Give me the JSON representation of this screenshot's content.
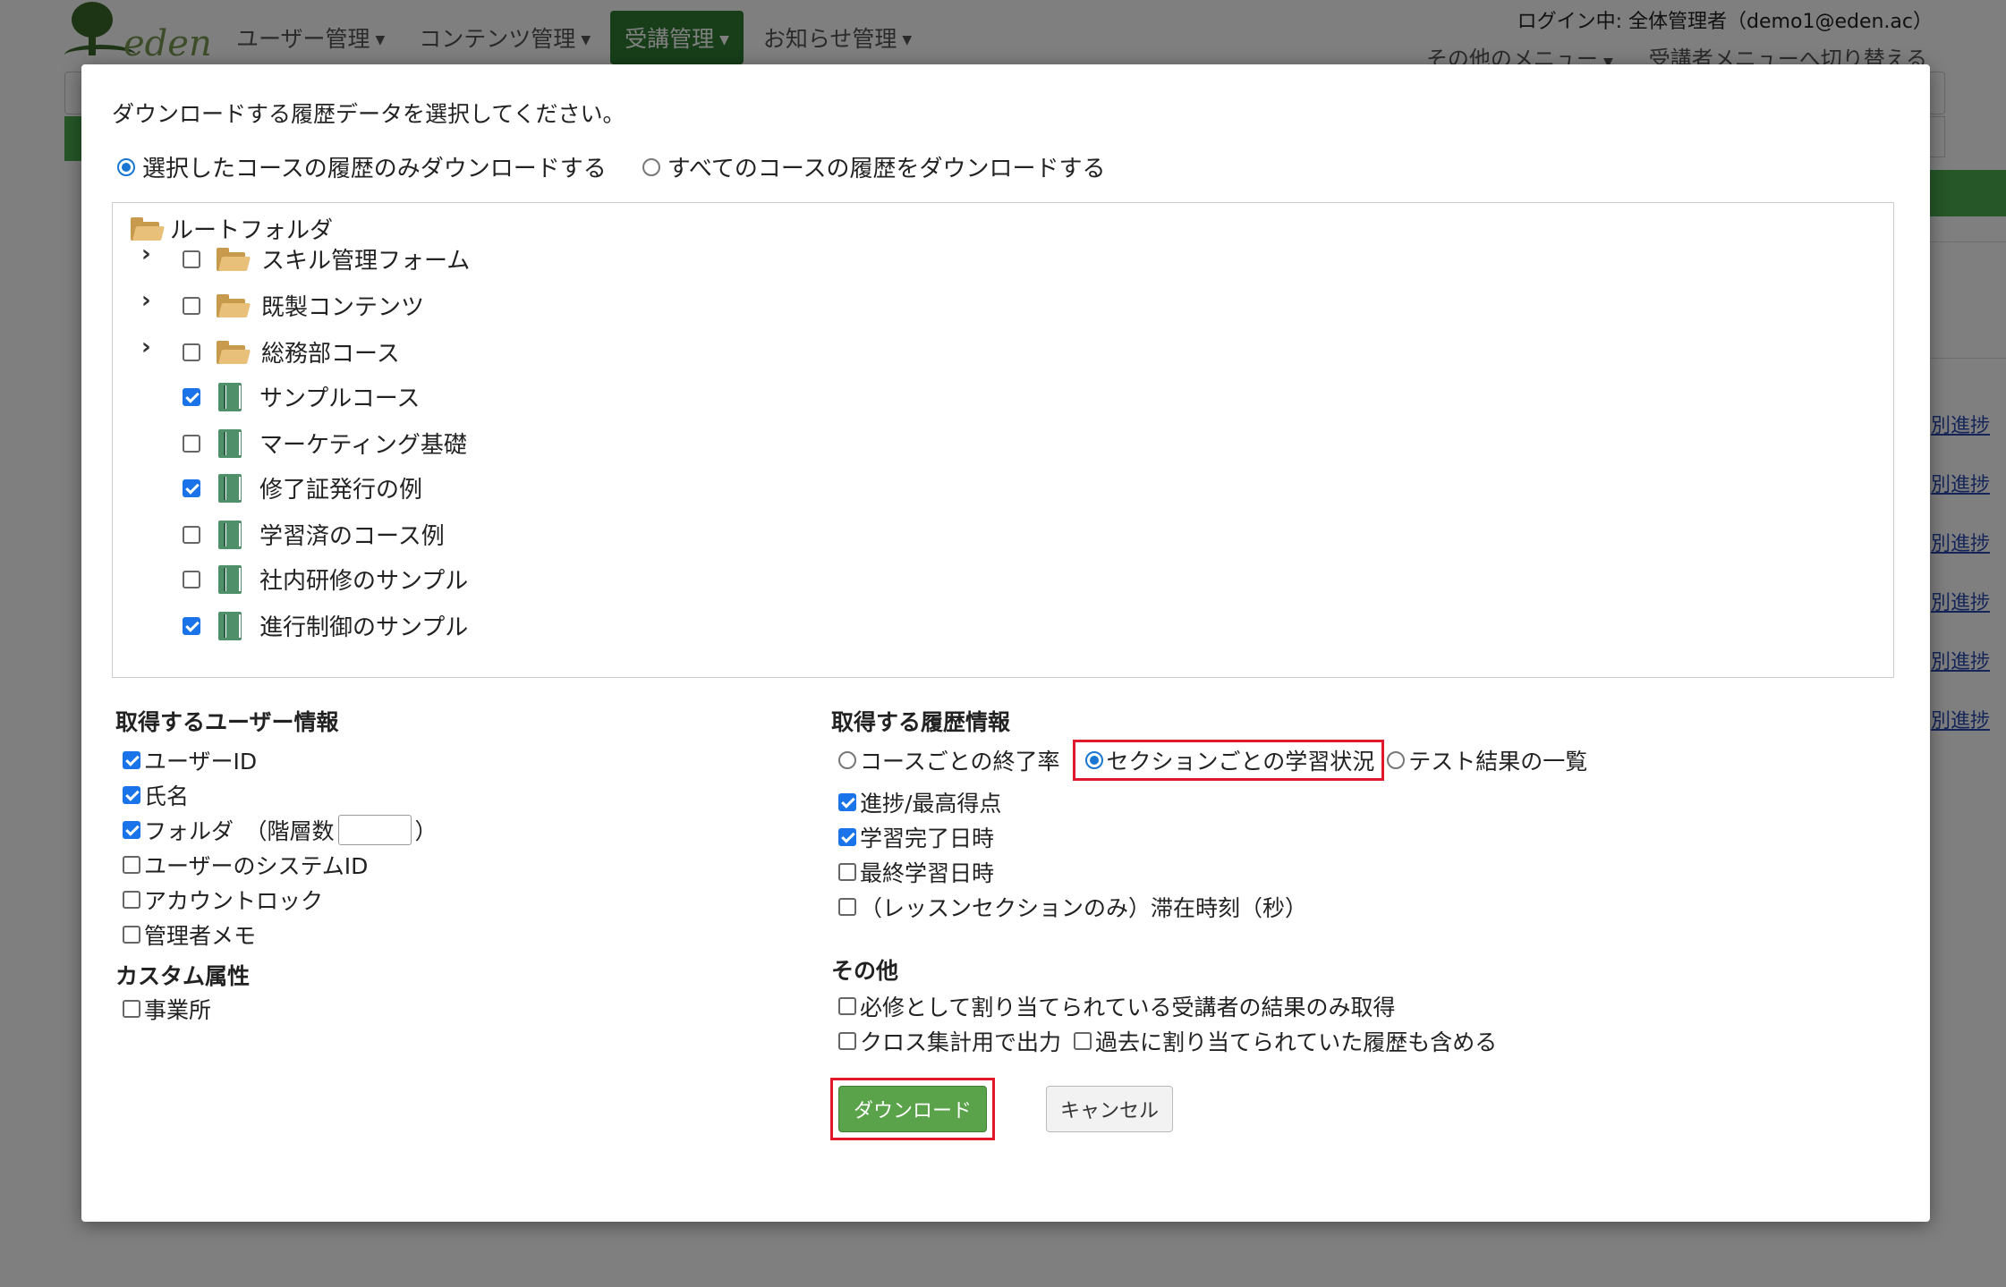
{
  "app": {
    "logo_text": "eden",
    "nav": [
      {
        "label": "ユーザー管理"
      },
      {
        "label": "コンテンツ管理"
      },
      {
        "label": "受講管理"
      },
      {
        "label": "お知らせ管理"
      }
    ],
    "login_info": "ログイン中: 全体管理者（demo1@eden.ac）",
    "other_menu": "その他のメニュー",
    "switch_menu": "受講者メニューへ切り替える",
    "row_link": "別進捗"
  },
  "modal": {
    "instruction": "ダウンロードする履歴データを選択してください。",
    "scope": {
      "selected_label": "選択したコースの履歴のみダウンロードする",
      "all_label": "すべてのコースの履歴をダウンロードする",
      "value": "selected"
    },
    "tree": {
      "root": "ルートフォルダ",
      "items": [
        {
          "type": "folder",
          "label": "スキル管理フォーム",
          "checked": false
        },
        {
          "type": "folder",
          "label": "既製コンテンツ",
          "checked": false
        },
        {
          "type": "folder",
          "label": "総務部コース",
          "checked": false
        },
        {
          "type": "course",
          "label": "サンプルコース",
          "checked": true
        },
        {
          "type": "course",
          "label": "マーケティング基礎",
          "checked": false
        },
        {
          "type": "course",
          "label": "修了証発行の例",
          "checked": true
        },
        {
          "type": "course",
          "label": "学習済のコース例",
          "checked": false
        },
        {
          "type": "course",
          "label": "社内研修のサンプル",
          "checked": false
        },
        {
          "type": "course",
          "label": "進行制御のサンプル",
          "checked": true
        }
      ]
    },
    "user_info": {
      "title": "取得するユーザー情報",
      "items": [
        {
          "label": "ユーザーID",
          "checked": true
        },
        {
          "label": "氏名",
          "checked": true
        },
        {
          "label": "フォルダ　（階層数",
          "suffix": "）",
          "checked": true
        },
        {
          "label": "ユーザーのシステムID",
          "checked": false
        },
        {
          "label": "アカウントロック",
          "checked": false
        },
        {
          "label": "管理者メモ",
          "checked": false
        }
      ]
    },
    "custom_attr": {
      "title": "カスタム属性",
      "items": [
        {
          "label": "事業所",
          "checked": false
        }
      ]
    },
    "history_info": {
      "title": "取得する履歴情報",
      "modes": [
        {
          "label": "コースごとの終了率",
          "selected": false
        },
        {
          "label": "セクションごとの学習状況",
          "selected": true
        },
        {
          "label": "テスト結果の一覧",
          "selected": false
        }
      ],
      "items": [
        {
          "label": "進捗/最高得点",
          "checked": true
        },
        {
          "label": "学習完了日時",
          "checked": true
        },
        {
          "label": "最終学習日時",
          "checked": false
        },
        {
          "label": "（レッスンセクションのみ）滞在時刻（秒）",
          "checked": false
        }
      ]
    },
    "other": {
      "title": "その他",
      "required_only": "必修として割り当てられている受講者の結果のみ取得",
      "cross_tab": "クロス集計用で出力",
      "include_past": "過去に割り当てられていた履歴も含める"
    },
    "buttons": {
      "download": "ダウンロード",
      "cancel": "キャンセル"
    }
  }
}
